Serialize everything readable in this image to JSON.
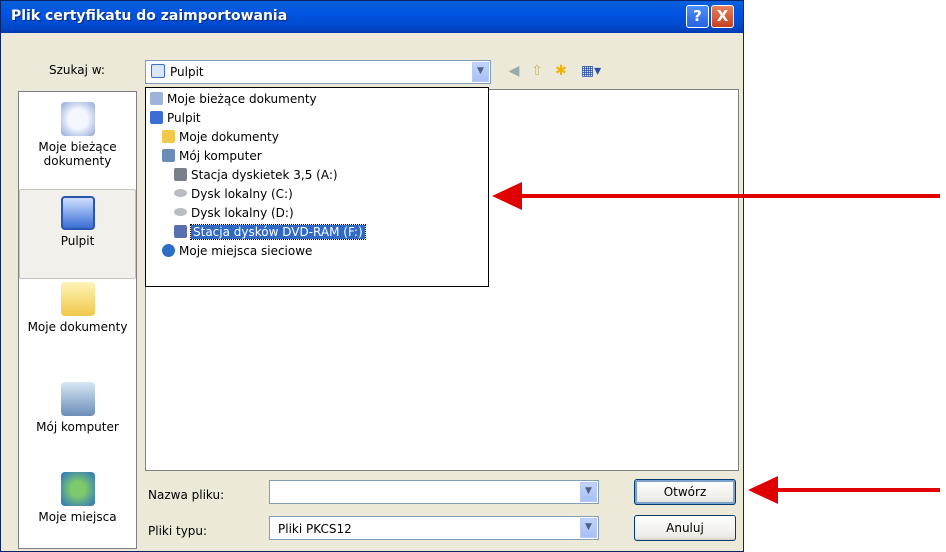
{
  "window": {
    "title": "Plik certyfikatu do zaimportowania",
    "help_button": "?",
    "close_button": "X"
  },
  "lookin": {
    "label": "Szukaj w:",
    "value": "Pulpit"
  },
  "toolbar": {
    "back_icon": "back-icon",
    "up_icon": "up-folder-icon",
    "new_folder_icon": "new-folder-icon",
    "view_icon": "view-menu-icon"
  },
  "places": [
    {
      "label": "Moje bieżące dokumenty",
      "icon": "recent-documents-icon"
    },
    {
      "label": "Pulpit",
      "icon": "desktop-icon",
      "selected": true
    },
    {
      "label": "Moje dokumenty",
      "icon": "my-documents-icon"
    },
    {
      "label": "Mój komputer",
      "icon": "my-computer-icon"
    },
    {
      "label": "Moje miejsca",
      "icon": "network-places-icon"
    }
  ],
  "dropdown": {
    "items": [
      {
        "label": "Moje bieżące dokumenty",
        "icon": "recent-documents-icon"
      },
      {
        "label": "Pulpit",
        "icon": "desktop-icon"
      },
      {
        "label": "Moje dokumenty",
        "icon": "my-documents-icon"
      },
      {
        "label": "Mój komputer",
        "icon": "my-computer-icon"
      },
      {
        "label": "Stacja dyskietek 3,5 (A:)",
        "icon": "floppy-drive-icon"
      },
      {
        "label": "Dysk lokalny (C:)",
        "icon": "hard-disk-icon"
      },
      {
        "label": "Dysk lokalny (D:)",
        "icon": "hard-disk-icon"
      },
      {
        "label": "Stacja dysków DVD-RAM (F:)",
        "icon": "dvd-drive-icon",
        "selected": true
      },
      {
        "label": "Moje miejsca sieciowe",
        "icon": "network-places-icon"
      }
    ]
  },
  "filename": {
    "label": "Nazwa pliku:",
    "value": ""
  },
  "filetype": {
    "label": "Pliki typu:",
    "value": "Pliki PKCS12"
  },
  "buttons": {
    "open": "Otwórz",
    "cancel": "Anuluj"
  },
  "colors": {
    "annotation_arrow": "#e00000",
    "selection": "#316ac5",
    "titlebar": "#0054e3"
  }
}
